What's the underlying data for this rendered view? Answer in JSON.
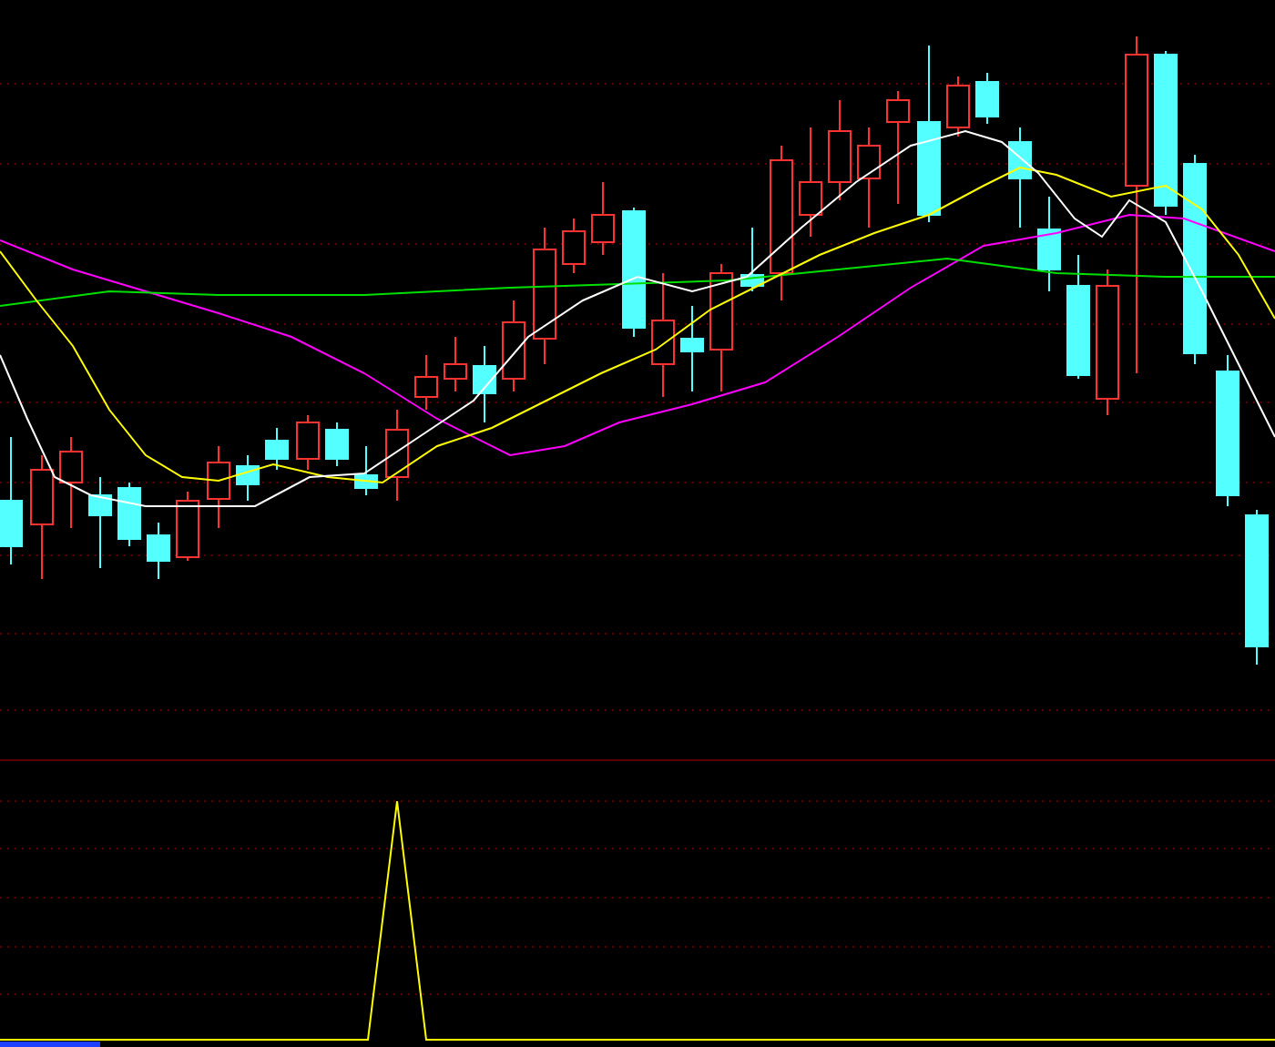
{
  "panels": [
    {
      "kind": "candlestick"
    },
    {
      "kind": "signal"
    }
  ]
}
